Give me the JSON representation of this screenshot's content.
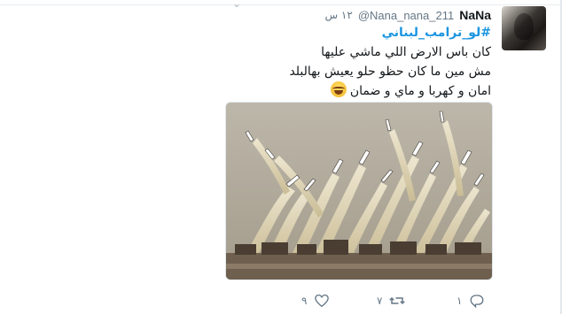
{
  "tweet": {
    "display_name": "NaNa",
    "handle": "@Nana_nana_211",
    "timestamp": "١٢ س",
    "hashtag": "#لو_ترامب_لبناني",
    "lines": [
      "كان باس الارض اللي ماشي عليها",
      "مش مين ما كان حظو حلو يعيش بهالبلد",
      "امان و كهربا و ماي و ضمان"
    ],
    "emoji": "face-with-tears-of-joy-emoji"
  },
  "actions": {
    "reply_count": "١",
    "retweet_count": "٧",
    "like_count": "٩"
  },
  "icons": {
    "reply": "reply-icon",
    "retweet": "retweet-icon",
    "like": "heart-icon",
    "more": "chevron-down-icon"
  },
  "colors": {
    "hashtag": "#1b95e0",
    "name": "#14171a",
    "meta": "#657786"
  }
}
